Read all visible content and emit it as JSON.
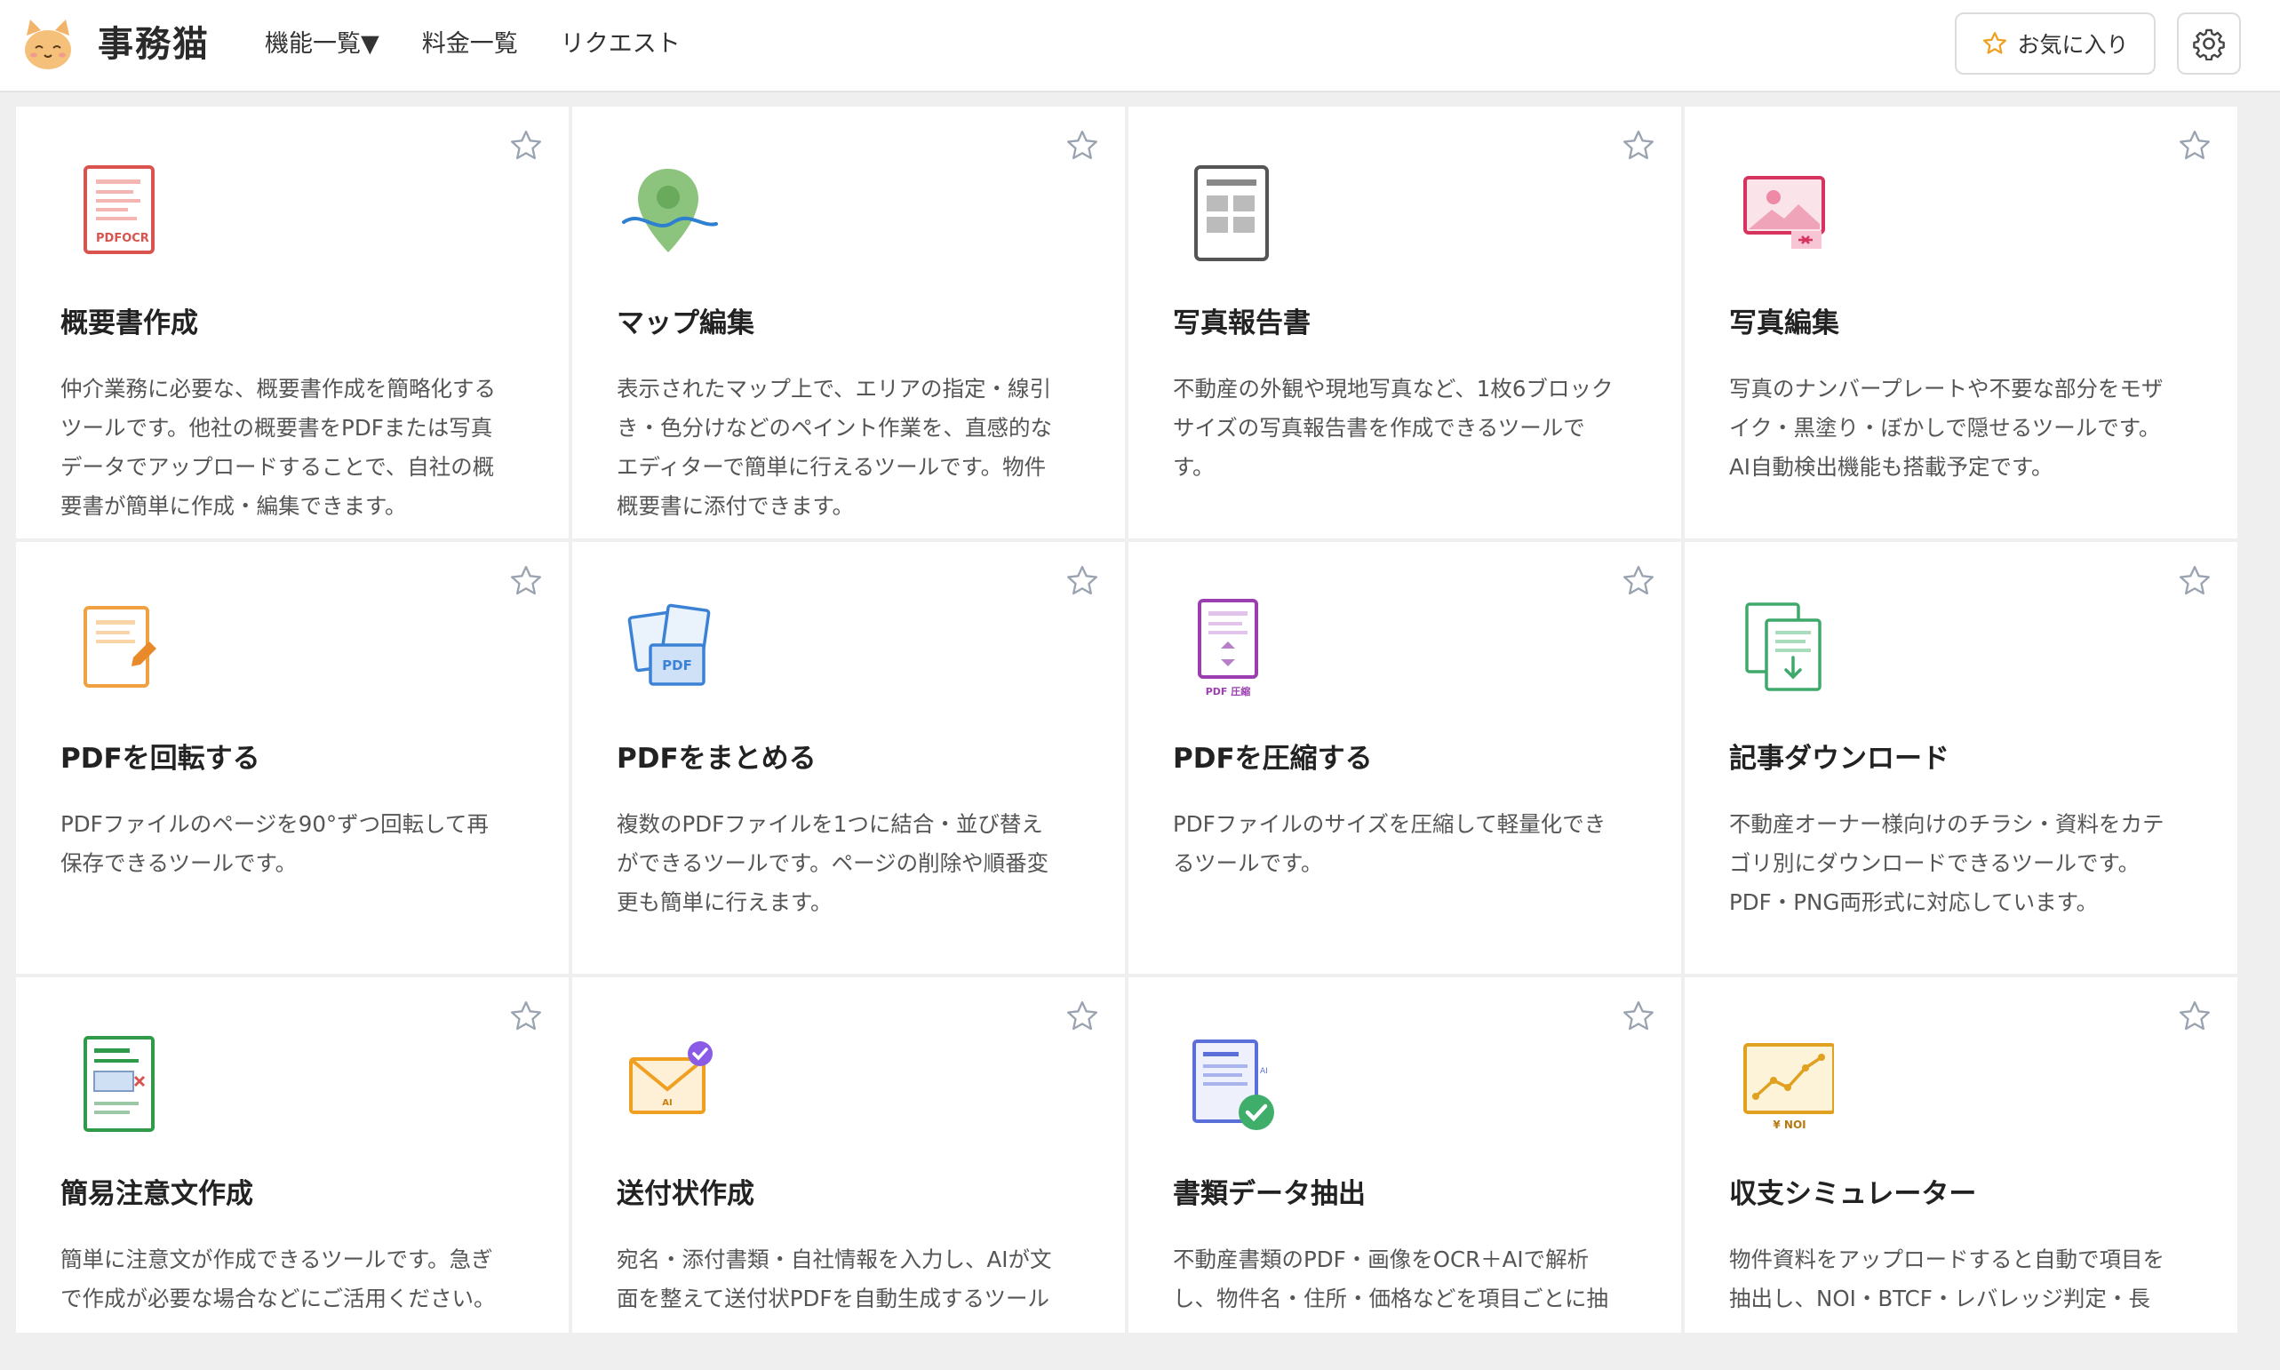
{
  "app": {
    "brand": "事務猫"
  },
  "nav": {
    "items": [
      {
        "label": "機能一覧▼"
      },
      {
        "label": "料金一覧"
      },
      {
        "label": "リクエスト"
      }
    ]
  },
  "header": {
    "favorites_label": "お気に入り",
    "favorites_icon": "star-outline-icon",
    "settings_icon": "gear-icon",
    "accent_color": "#f0a020"
  },
  "cards": [
    {
      "title": "概要書作成",
      "desc": "仲介業務に必要な、概要書作成を簡略化する\nツールです。他社の概要書をPDFまたは写真\nデータでアップロードすることで、自社の概\n要書が簡単に作成・編集できます。",
      "icon": "pdf-ocr-icon",
      "color": "#d9534f",
      "icon_label": "PDFOCR"
    },
    {
      "title": "マップ編集",
      "desc": "表示されたマップ上で、エリアの指定・線引\nき・色分けなどのペイント作業を、直感的な\nエディターで簡単に行えるツールです。物件\n概要書に添付できます。",
      "icon": "map-pin-icon",
      "color": "#7cbf6e"
    },
    {
      "title": "写真報告書",
      "desc": "不動産の外観や現地写真など、1枚6ブロック\nサイズの写真報告書を作成できるツールで\nす。",
      "icon": "photo-report-icon",
      "color": "#666666"
    },
    {
      "title": "写真編集",
      "desc": "写真のナンバープレートや不要な部分をモザ\nイク・黒塗り・ぼかしで隠せるツールです。\nAI自動検出機能も搭載予定です。",
      "icon": "photo-edit-icon",
      "color": "#e0436e"
    },
    {
      "title": "PDFを回転する",
      "desc": "PDFファイルのページを90°ずつ回転して再\n保存できるツールです。",
      "icon": "pdf-rotate-icon",
      "color": "#f0a040"
    },
    {
      "title": "PDFをまとめる",
      "desc": "複数のPDFファイルを1つに結合・並び替え\nができるツールです。ページの削除や順番変\n更も簡単に行えます。",
      "icon": "pdf-merge-icon",
      "color": "#3b82d6",
      "icon_label": "PDF"
    },
    {
      "title": "PDFを圧縮する",
      "desc": "PDFファイルのサイズを圧縮して軽量化でき\nるツールです。",
      "icon": "pdf-compress-icon",
      "color": "#9b3fb0",
      "icon_label": "PDF 圧縮"
    },
    {
      "title": "記事ダウンロード",
      "desc": "不動産オーナー様向けのチラシ・資料をカテ\nゴリ別にダウンロードできるツールです。\nPDF・PNG両形式に対応しています。",
      "icon": "document-download-icon",
      "color": "#3fa96b"
    },
    {
      "title": "簡易注意文作成",
      "desc": "簡単に注意文が作成できるツールです。急ぎ\nで作成が必要な場合などにご活用ください。",
      "icon": "notice-form-icon",
      "color": "#2e9a4a"
    },
    {
      "title": "送付状作成",
      "desc": "宛名・添付書類・自社情報を入力し、AIが文\n面を整えて送付状PDFを自動生成するツール",
      "icon": "ai-envelope-icon",
      "color": "#f0a020",
      "icon_label": "AI"
    },
    {
      "title": "書類データ抽出",
      "desc": "不動産書類のPDF・画像をOCR＋AIで解析\nし、物件名・住所・価格などを項目ごとに抽",
      "icon": "document-extract-icon",
      "color": "#5a6fd8",
      "icon_label": "AI"
    },
    {
      "title": "収支シミュレーター",
      "desc": "物件資料をアップロードすると自動で項目を\n抽出し、NOI・BTCF・レバレッジ判定・長",
      "icon": "income-chart-icon",
      "color": "#e0a020",
      "icon_label": "¥ NOI"
    }
  ]
}
